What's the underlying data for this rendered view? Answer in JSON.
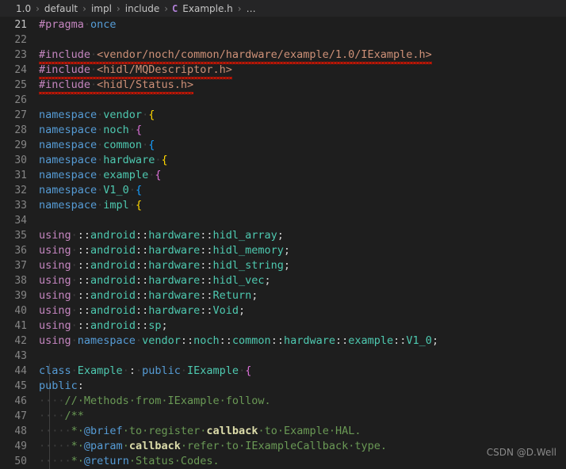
{
  "breadcrumb": {
    "separator": "›",
    "items": [
      {
        "label": "1.0",
        "icon": null
      },
      {
        "label": "default",
        "icon": null
      },
      {
        "label": "impl",
        "icon": null
      },
      {
        "label": "include",
        "icon": null
      },
      {
        "label": "Example.h",
        "icon": "c-header-file-icon",
        "icon_glyph": "C"
      },
      {
        "label": "…",
        "icon": null
      }
    ]
  },
  "editor": {
    "language": "cpp",
    "file_name": "Example.h",
    "first_line_number": 21,
    "last_line_number": 50,
    "active_line_number": 21,
    "whitespace_dot": "·",
    "colors": {
      "background": "#1e1e1e",
      "breadcrumb_background": "#252526",
      "line_number": "#858585",
      "active_line_number": "#c6c6c6",
      "keyword": "#569cd6",
      "preprocessor": "#c586c0",
      "type": "#4ec9b0",
      "string": "#ce9178",
      "comment": "#6a9955",
      "doc_bold": "#dcdcaa",
      "error_squiggle": "#e51400",
      "bracket_level_1": "#ffd700",
      "bracket_level_2": "#da70d6",
      "bracket_level_3": "#179fff",
      "indent_guide": "#404040"
    },
    "lines": [
      {
        "n": 21,
        "text": "#pragma once"
      },
      {
        "n": 22,
        "text": ""
      },
      {
        "n": 23,
        "text": "#include <vendor/noch/common/hardware/example/1.0/IExample.h>",
        "error": true
      },
      {
        "n": 24,
        "text": "#include <hidl/MQDescriptor.h>",
        "error": true
      },
      {
        "n": 25,
        "text": "#include <hidl/Status.h>",
        "error": true
      },
      {
        "n": 26,
        "text": ""
      },
      {
        "n": 27,
        "text": "namespace vendor {"
      },
      {
        "n": 28,
        "text": "namespace noch {"
      },
      {
        "n": 29,
        "text": "namespace common {"
      },
      {
        "n": 30,
        "text": "namespace hardware {"
      },
      {
        "n": 31,
        "text": "namespace example {"
      },
      {
        "n": 32,
        "text": "namespace V1_0 {"
      },
      {
        "n": 33,
        "text": "namespace impl {"
      },
      {
        "n": 34,
        "text": ""
      },
      {
        "n": 35,
        "text": "using ::android::hardware::hidl_array;"
      },
      {
        "n": 36,
        "text": "using ::android::hardware::hidl_memory;"
      },
      {
        "n": 37,
        "text": "using ::android::hardware::hidl_string;"
      },
      {
        "n": 38,
        "text": "using ::android::hardware::hidl_vec;"
      },
      {
        "n": 39,
        "text": "using ::android::hardware::Return;"
      },
      {
        "n": 40,
        "text": "using ::android::hardware::Void;"
      },
      {
        "n": 41,
        "text": "using ::android::sp;"
      },
      {
        "n": 42,
        "text": "using namespace vendor::noch::common::hardware::example::V1_0;"
      },
      {
        "n": 43,
        "text": ""
      },
      {
        "n": 44,
        "text": "class Example : public IExample {"
      },
      {
        "n": 45,
        "text": "public:"
      },
      {
        "n": 46,
        "text": "    // Methods from IExample follow."
      },
      {
        "n": 47,
        "text": "    /**"
      },
      {
        "n": 48,
        "text": "     * @brief to register callback to Example HAL."
      },
      {
        "n": 49,
        "text": "     * @param callback refer to IExampleCallback type."
      },
      {
        "n": 50,
        "text": "     * @return Status Codes."
      }
    ]
  },
  "watermark": {
    "text": "CSDN @D.Well"
  }
}
